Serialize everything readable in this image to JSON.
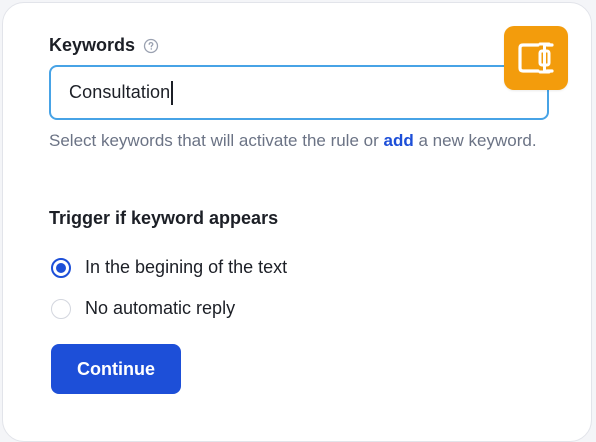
{
  "keywords_field": {
    "label": "Keywords",
    "help_icon": "question-circle-icon",
    "value": "Consultation",
    "help_text_before": "Select keywords that will activate the rule or ",
    "help_link": "add",
    "help_text_after": " a new keyword."
  },
  "extension_badge": {
    "icon": "text-cursor-box-icon",
    "color": "#f39c0c"
  },
  "trigger": {
    "title": "Trigger if keyword appears",
    "options": [
      {
        "label": "In the begining of the text",
        "checked": true
      },
      {
        "label": "No automatic reply",
        "checked": false
      }
    ]
  },
  "actions": {
    "continue_label": "Continue"
  },
  "colors": {
    "accent": "#1d4fd8",
    "focus_border": "#47a3e6",
    "muted_text": "#6b7385"
  }
}
